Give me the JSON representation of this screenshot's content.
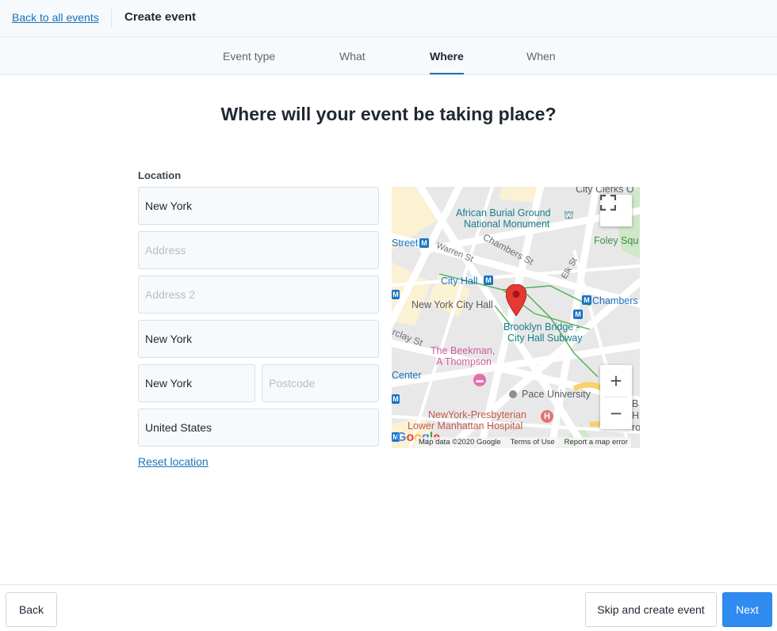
{
  "header": {
    "back_link": "Back to all events",
    "title": "Create event"
  },
  "steps": [
    {
      "label": "Event type",
      "active": false
    },
    {
      "label": "What",
      "active": false
    },
    {
      "label": "Where",
      "active": true
    },
    {
      "label": "When",
      "active": false
    }
  ],
  "main": {
    "heading": "Where will your event be taking place?",
    "location_label": "Location",
    "fields": {
      "venue": {
        "value": "New York",
        "placeholder": ""
      },
      "address": {
        "value": "",
        "placeholder": "Address"
      },
      "address2": {
        "value": "",
        "placeholder": "Address 2"
      },
      "city": {
        "value": "New York",
        "placeholder": ""
      },
      "state": {
        "value": "New York",
        "placeholder": ""
      },
      "postcode": {
        "value": "",
        "placeholder": "Postcode"
      },
      "country": {
        "value": "United States",
        "placeholder": ""
      }
    },
    "reset_link": "Reset location"
  },
  "map": {
    "labels": {
      "city_clerks": "City Clerks O",
      "african_burial": "African Burial Ground",
      "national_monument": "National Monument",
      "foley_sq": "Foley Squ",
      "street": "Street",
      "warren_st": "Warren St",
      "chambers_st": "Chambers St",
      "elk_st": "Elk St",
      "city_hall": "City Hall",
      "nyc_hall": "New York City Hall",
      "chambers": "Chambers",
      "brooklyn_bridge": "Brooklyn Bridge -",
      "city_hall_subway": "City Hall Subway",
      "barclay_st": "rclay St",
      "beekman": "The Beekman,",
      "thompson": "A Thompson",
      "center": "Center",
      "pace": "Pace University",
      "nyp": "NewYork-Presbyterian",
      "lower_manhattan": "Lower Manhattan Hospital",
      "frag_b": "B",
      "frag_h": "H",
      "frag_o": "ro"
    },
    "attribution": {
      "map_data": "Map data ©2020 Google",
      "terms": "Terms of Use",
      "report": "Report a map error"
    },
    "logo": {
      "g1": "G",
      "o1": "o",
      "o2": "o",
      "g2": "g",
      "l": "l",
      "e": "e"
    },
    "zoom_in": "+",
    "zoom_out": "−",
    "icons": {
      "pin": "map-marker",
      "fullscreen": "fullscreen",
      "monument": "monument",
      "hotel": "hotel",
      "hospital": "hospital",
      "subway": "subway"
    }
  },
  "footer": {
    "back": "Back",
    "skip": "Skip and create event",
    "next": "Next"
  },
  "colors": {
    "accent": "#1a73b8",
    "primary_button": "#2f8bf0",
    "map_pin": "#e53935"
  }
}
